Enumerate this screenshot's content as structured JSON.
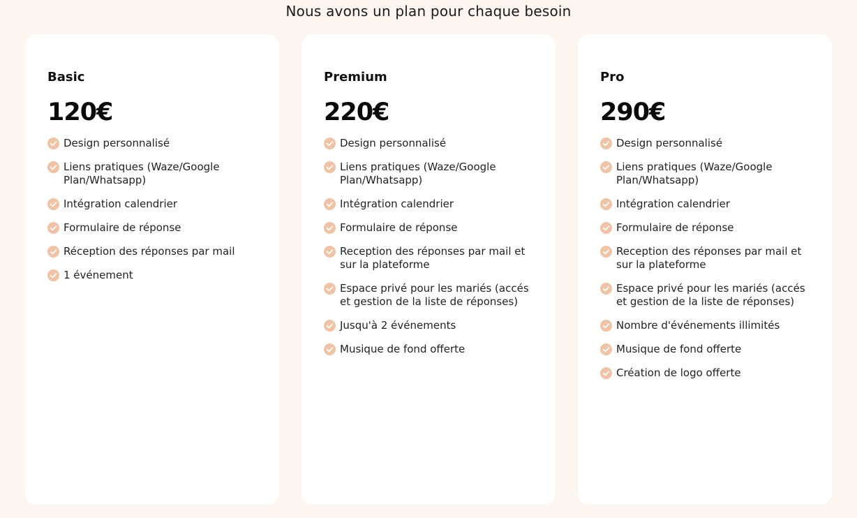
{
  "page": {
    "heading": "Nous avons un plan pour chaque besoin"
  },
  "colors": {
    "background": "#fcf5f0",
    "card": "#ffffff",
    "check_accent": "#f1c3a4"
  },
  "plans": [
    {
      "name": "Basic",
      "price": "120€",
      "features": [
        "Design personnalisé",
        "Liens pratiques (Waze/Google Plan/Whatsapp)",
        "Intégration calendrier",
        "Formulaire de réponse",
        "Réception des réponses par mail",
        "1 événement"
      ]
    },
    {
      "name": "Premium",
      "price": "220€",
      "features": [
        "Design personnalisé",
        "Liens pratiques (Waze/Google Plan/Whatsapp)",
        "Intégration calendrier",
        "Formulaire de réponse",
        "Reception des réponses par mail et sur la plateforme",
        "Espace privé pour les mariés (accés et gestion de la liste de réponses)",
        "Jusqu'à 2 événements",
        "Musique de fond offerte"
      ]
    },
    {
      "name": "Pro",
      "price": "290€",
      "features": [
        "Design personnalisé",
        "Liens pratiques (Waze/Google Plan/Whatsapp)",
        "Intégration calendrier",
        "Formulaire de réponse",
        "Reception des réponses par mail et sur la plateforme",
        "Espace privé pour les mariés (accés et gestion de la liste de réponses)",
        "Nombre d'événements illimités",
        "Musique de fond offerte",
        "Création de logo offerte"
      ]
    }
  ],
  "icons": {
    "feature_bullet": "check-circle-icon"
  }
}
